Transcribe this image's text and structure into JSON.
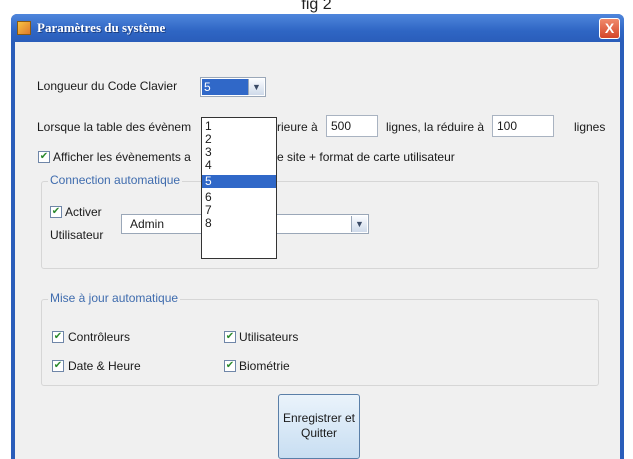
{
  "caption": "fig 2",
  "window": {
    "title": "Paramètres du système",
    "close_label": "X"
  },
  "keyboard_code": {
    "label": "Longueur du Code Clavier",
    "value": "5"
  },
  "event_table": {
    "prefix": "Lorsque la table des évènem",
    "middle": "rieure à",
    "max_lines": "500",
    "lines_reduce_label": "lignes, la réduire à",
    "reduce_to": "100",
    "suffix": "lignes"
  },
  "show_events": {
    "checked": true,
    "label_start": "Afficher les évènements a",
    "label_end": "e site + format de carte utilisateur"
  },
  "auto_connection": {
    "title": "Connection automatique",
    "enable_label": "Activer",
    "enable_checked": true,
    "user_label": "Utilisateur",
    "user_value": "Admin"
  },
  "auto_update": {
    "title": "Mise à jour automatique",
    "items": [
      {
        "label": "Contrôleurs",
        "checked": true
      },
      {
        "label": "Utilisateurs",
        "checked": true
      },
      {
        "label": "Date & Heure",
        "checked": true
      },
      {
        "label": "Biométrie",
        "checked": true
      }
    ]
  },
  "save_button": {
    "line1": "Enregistrer et",
    "line2": "Quitter"
  },
  "dropdown": {
    "options": [
      "1",
      "2",
      "3",
      "4",
      "5",
      "6",
      "7",
      "8"
    ],
    "selected": "5"
  },
  "icons": {
    "arrow": "chevron-down-icon",
    "check": "checkmark-icon"
  }
}
